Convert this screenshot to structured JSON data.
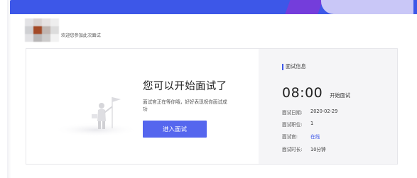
{
  "header": {
    "welcome_text": "欢迎您参加此次面试"
  },
  "main": {
    "headline": "您可以开始面试了",
    "description": "面试官正在等你哦，好好表现祝你面试成功",
    "enter_button": "进入面试"
  },
  "info_panel": {
    "title": "面试信息",
    "time": "08:00",
    "time_label": "开始面试",
    "rows": [
      {
        "label": "面试日期:",
        "value": "2020-02-29"
      },
      {
        "label": "面试职位:",
        "value": "1"
      },
      {
        "label": "面试官:",
        "value": "在线"
      },
      {
        "label": "面试时长:",
        "value": "10分钟"
      }
    ]
  },
  "colors": {
    "accent": "#3d57e8",
    "button": "#5566ee",
    "panel_bg": "#f5f5f7"
  },
  "icons": {
    "avatar": "blurred-avatar",
    "illustration": "person-with-flag-illustration"
  }
}
